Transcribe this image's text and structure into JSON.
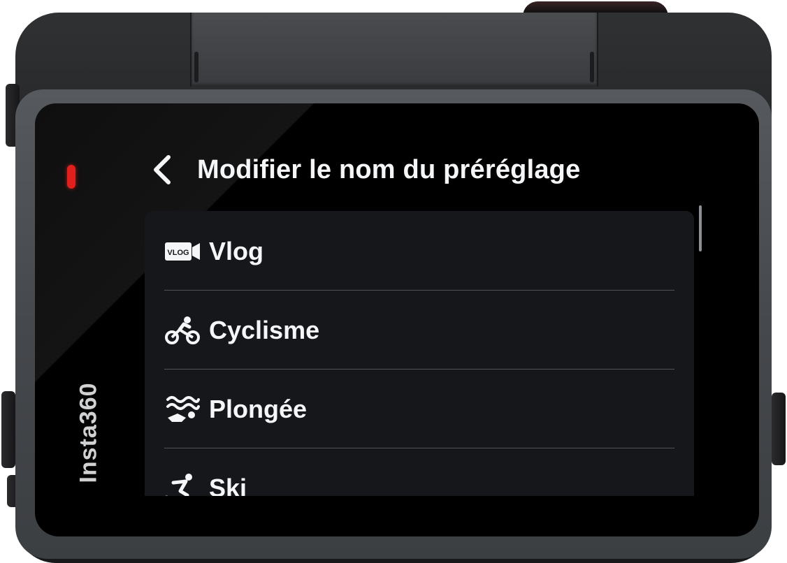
{
  "device": {
    "brand_text": "Insta360"
  },
  "screen": {
    "title": "Modifier le nom du préréglage",
    "back_icon": "chevron-left-icon",
    "presets": [
      {
        "label": "Vlog",
        "icon": "vlog-camera-icon",
        "icon_text": "VLOG"
      },
      {
        "label": "Cyclisme",
        "icon": "cycling-icon"
      },
      {
        "label": "Plongée",
        "icon": "diving-icon"
      },
      {
        "label": "Ski",
        "icon": "skiing-icon"
      }
    ]
  },
  "colors": {
    "text": "#f4f6f8",
    "panel": "#15171b",
    "divider": "#4f545b",
    "record_led": "#e0201c"
  }
}
